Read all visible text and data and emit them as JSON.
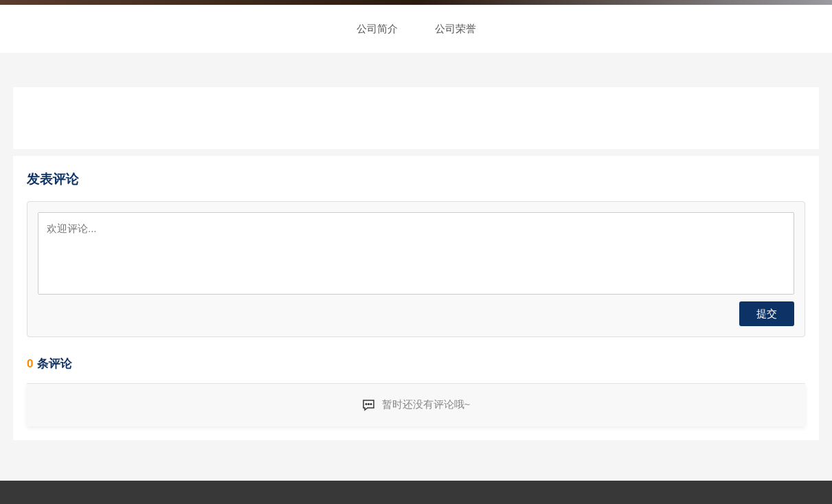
{
  "nav": {
    "items": [
      {
        "label": "公司简介"
      },
      {
        "label": "公司荣誉"
      }
    ]
  },
  "comment_form": {
    "title": "发表评论",
    "placeholder": "欢迎评论...",
    "submit": "提交"
  },
  "comments": {
    "count": "0",
    "label": "条评论",
    "empty_message": "暂时还没有评论哦~"
  }
}
